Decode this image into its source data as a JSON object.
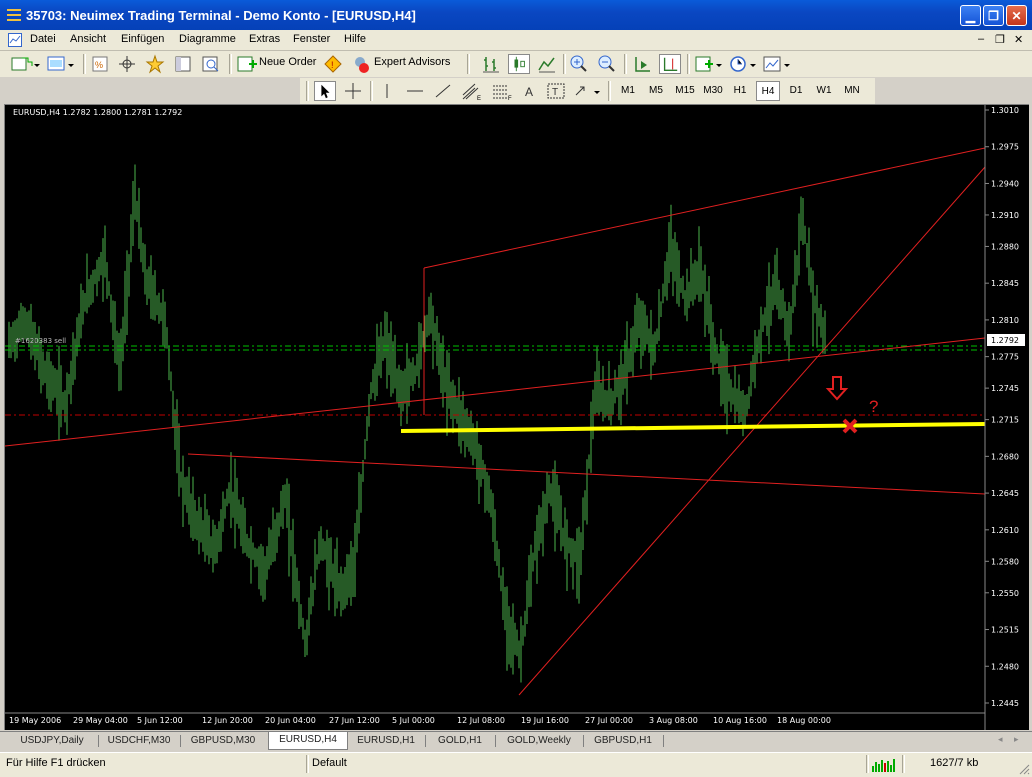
{
  "window": {
    "title": "35703: Neuimex Trading Terminal - Demo Konto - [EURUSD,H4]"
  },
  "menu": [
    "Datei",
    "Ansicht",
    "Einfügen",
    "Diagramme",
    "Extras",
    "Fenster",
    "Hilfe"
  ],
  "toolbar": {
    "new_order": "Neue Order",
    "expert_advisors": "Expert Advisors"
  },
  "timeframes": [
    "M1",
    "M5",
    "M15",
    "M30",
    "H1",
    "H4",
    "D1",
    "W1",
    "MN"
  ],
  "active_timeframe": "H4",
  "chart": {
    "info": "EURUSD,H4  1.2782 1.2800 1.2781 1.2792",
    "order_label": "#1620383 sell",
    "current_price": "1.2792",
    "price_labels": [
      "1.3010",
      "1.2975",
      "1.2940",
      "1.2910",
      "1.2880",
      "1.2845",
      "1.2810",
      "1.2775",
      "1.2745",
      "1.2715",
      "1.2680",
      "1.2645",
      "1.2610",
      "1.2580",
      "1.2550",
      "1.2515",
      "1.2480",
      "1.2445"
    ],
    "time_labels": [
      "19 May 2006",
      "29 May 04:00",
      "5 Jun 12:00",
      "12 Jun 20:00",
      "20 Jun 04:00",
      "27 Jun 12:00",
      "5 Jul 00:00",
      "12 Jul 08:00",
      "19 Jul 16:00",
      "27 Jul 00:00",
      "3 Aug 08:00",
      "10 Aug 16:00",
      "18 Aug 00:00"
    ],
    "question_mark": "?",
    "colors": {
      "bars": "#4db34d",
      "trendlines": "#e02020",
      "support": "#ffff00",
      "order": "#00c000",
      "background": "#000000"
    }
  },
  "tabs": [
    "USDJPY,Daily",
    "USDCHF,M30",
    "GBPUSD,M30",
    "EURUSD,H4",
    "EURUSD,H1",
    "GOLD,H1",
    "GOLD,Weekly",
    "GBPUSD,H1"
  ],
  "active_tab": "EURUSD,H4",
  "status": {
    "help": "Für Hilfe F1 drücken",
    "profile": "Default",
    "traffic": "1627/7 kb"
  }
}
